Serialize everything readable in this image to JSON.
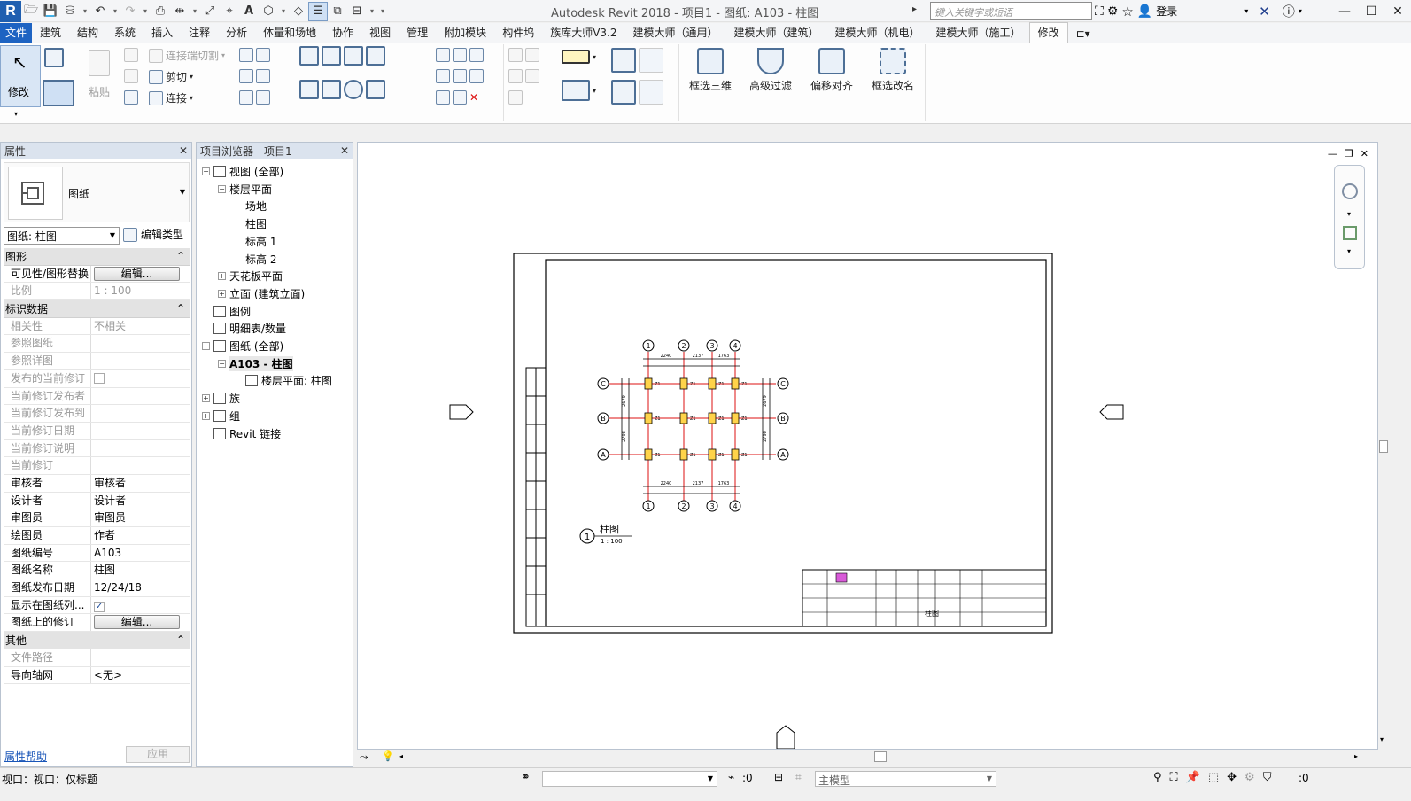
{
  "window": {
    "title": "Autodesk Revit 2018 -    项目1 - 图纸: A103 - 柱图",
    "search_placeholder": "键入关键字或短语",
    "login": "登录",
    "app_letter": "R",
    "text_tool": "A"
  },
  "tabs": [
    "文件",
    "建筑",
    "结构",
    "系统",
    "插入",
    "注释",
    "分析",
    "体量和场地",
    "协作",
    "视图",
    "管理",
    "附加模块",
    "构件坞",
    "族库大师V3.2",
    "建模大师（通用）",
    "建模大师（建筑）",
    "建模大师（机电）",
    "建模大师（施工）",
    "修改"
  ],
  "ribbon": {
    "modify": "修改",
    "paste": "粘贴",
    "cut_join": "连接端切割",
    "cut": "剪切",
    "join": "连接",
    "select_3d": "框选三维",
    "adv_filter": "高级过滤",
    "offset_align": "偏移对齐",
    "rename": "框选改名"
  },
  "properties": {
    "header": "属性",
    "type_name": "图纸",
    "instance_select": "图纸: 柱图",
    "edit_type": "编辑类型",
    "groups": {
      "graphics": "图形",
      "identity": "标识数据",
      "other": "其他"
    },
    "graphics_rows": [
      {
        "k": "可见性/图形替换",
        "v": "编辑...",
        "type": "button"
      },
      {
        "k": "比例",
        "v": "1 : 100",
        "dim": true
      }
    ],
    "identity_rows": [
      {
        "k": "相关性",
        "v": "不相关",
        "dim": true
      },
      {
        "k": "参照图纸",
        "v": "",
        "dim": true
      },
      {
        "k": "参照详图",
        "v": "",
        "dim": true
      },
      {
        "k": "发布的当前修订",
        "v": "",
        "dim": true,
        "type": "checkbox"
      },
      {
        "k": "当前修订发布者",
        "v": "",
        "dim": true
      },
      {
        "k": "当前修订发布到",
        "v": "",
        "dim": true
      },
      {
        "k": "当前修订日期",
        "v": "",
        "dim": true
      },
      {
        "k": "当前修订说明",
        "v": "",
        "dim": true
      },
      {
        "k": "当前修订",
        "v": "",
        "dim": true
      },
      {
        "k": "审核者",
        "v": "审核者"
      },
      {
        "k": "设计者",
        "v": "设计者"
      },
      {
        "k": "审图员",
        "v": "审图员"
      },
      {
        "k": "绘图员",
        "v": "作者"
      },
      {
        "k": "图纸编号",
        "v": "A103"
      },
      {
        "k": "图纸名称",
        "v": "柱图"
      },
      {
        "k": "图纸发布日期",
        "v": "12/24/18"
      },
      {
        "k": "显示在图纸列...",
        "v": "✓",
        "type": "checkbox"
      },
      {
        "k": "图纸上的修订",
        "v": "编辑...",
        "type": "button"
      }
    ],
    "other_rows": [
      {
        "k": "文件路径",
        "v": "",
        "dim": true
      },
      {
        "k": "导向轴网",
        "v": "<无>"
      }
    ],
    "help": "属性帮助",
    "apply": "应用"
  },
  "browser": {
    "header": "项目浏览器 - 项目1",
    "nodes": [
      {
        "label": "视图 (全部)",
        "level": 0,
        "pm": "−",
        "icon": true
      },
      {
        "label": "楼层平面",
        "level": 1,
        "pm": "−"
      },
      {
        "label": "场地",
        "level": 2
      },
      {
        "label": "柱图",
        "level": 2
      },
      {
        "label": "标高 1",
        "level": 2
      },
      {
        "label": "标高 2",
        "level": 2
      },
      {
        "label": "天花板平面",
        "level": 1,
        "pm": "+"
      },
      {
        "label": "立面 (建筑立面)",
        "level": 1,
        "pm": "+"
      },
      {
        "label": "图例",
        "level": 0,
        "icon": true
      },
      {
        "label": "明细表/数量",
        "level": 0,
        "icon": true
      },
      {
        "label": "图纸 (全部)",
        "level": 0,
        "pm": "−",
        "icon": true
      },
      {
        "label": "A103 - 柱图",
        "level": 1,
        "pm": "−",
        "bold": true
      },
      {
        "label": "楼层平面: 柱图",
        "level": 2,
        "icon": true
      },
      {
        "label": "族",
        "level": 0,
        "pm": "+",
        "icon": true
      },
      {
        "label": "组",
        "level": 0,
        "pm": "+",
        "icon": true
      },
      {
        "label": "Revit 链接",
        "level": 0,
        "icon": true
      }
    ]
  },
  "drawing": {
    "grid_cols": [
      "1",
      "2",
      "3",
      "4"
    ],
    "grid_rows": [
      "C",
      "B",
      "A"
    ],
    "col_dims": [
      "2240",
      "2137",
      "1763"
    ],
    "row_dims": [
      "2679",
      "2798"
    ],
    "column_tag": "Z1",
    "view_number": "1",
    "view_title": "柱图",
    "view_scale": "1 : 100",
    "title_block_drawing_name": "柱图"
  },
  "status": {
    "left": "视口：视口：仅标题",
    "zero_value": ":0",
    "model": "主模型",
    "filter_value": ":0"
  }
}
